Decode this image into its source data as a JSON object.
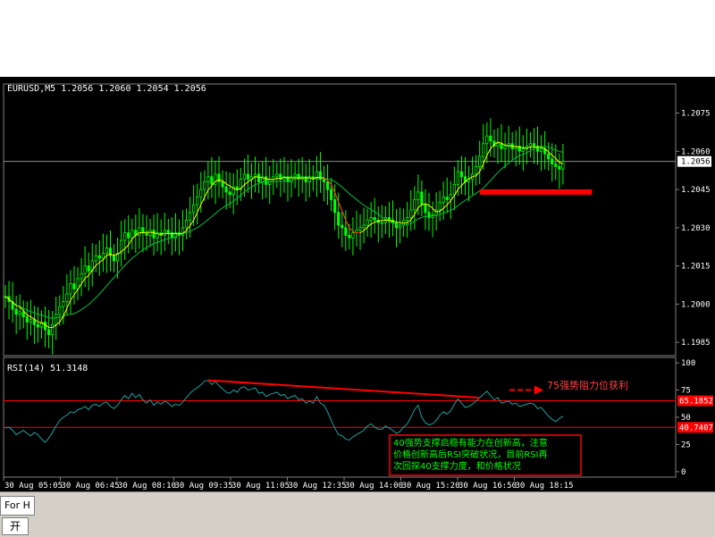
{
  "chart_data": [
    {
      "type": "line",
      "panel": "price",
      "symbol_header": "EURUSD,M5  1.2056 1.2060 1.2054 1.2056",
      "y_ticks": [
        "1.2075",
        "1.2060",
        "1.2045",
        "1.2030",
        "1.2015",
        "1.2000",
        "1.1985"
      ],
      "ylim": [
        1.19798,
        1.20864
      ],
      "current_price_label": "1.2056",
      "current_price": 1.2056,
      "x_time_labels": [
        "30 Aug 05:05",
        "30 Aug 06:45",
        "30 Aug 08:10",
        "30 Aug 09:35",
        "30 Aug 11:05",
        "30 Aug 12:35",
        "30 Aug 14:00",
        "30 Aug 15:20",
        "30 Aug 16:50",
        "30 Aug 18:15"
      ],
      "x_index_range": [
        0,
        156
      ],
      "close_prices": [
        1.2003,
        1.2001,
        1.1998,
        1.1996,
        1.1997,
        1.1995,
        1.1993,
        1.1994,
        1.1992,
        1.1991,
        1.1993,
        1.199,
        1.1988,
        1.1992,
        1.1996,
        1.1999,
        1.2001,
        1.2004,
        1.2008,
        1.2006,
        1.201,
        1.2012,
        1.2015,
        1.2013,
        1.2017,
        1.2019,
        1.2018,
        1.202,
        1.2022,
        1.2019,
        1.2017,
        1.202,
        1.2025,
        1.2028,
        1.2026,
        1.2029,
        1.2027,
        1.203,
        1.2028,
        1.2027,
        1.2029,
        1.2026,
        1.2028,
        1.2027,
        1.2029,
        1.2028,
        1.2026,
        1.2028,
        1.2027,
        1.203,
        1.2033,
        1.2036,
        1.2039,
        1.2042,
        1.2045,
        1.2048,
        1.205,
        1.2047,
        1.2051,
        1.2048,
        1.2046,
        1.2044,
        1.2043,
        1.2046,
        1.2045,
        1.2049,
        1.2051,
        1.2049,
        1.205,
        1.2051,
        1.2048,
        1.205,
        1.2047,
        1.2049,
        1.205,
        1.2051,
        1.2049,
        1.205,
        1.2048,
        1.205,
        1.2051,
        1.2049,
        1.205,
        1.2048,
        1.205,
        1.2049,
        1.2052,
        1.2049,
        1.2048,
        1.2045,
        1.2041,
        1.2036,
        1.2031,
        1.203,
        1.2027,
        1.2026,
        1.2028,
        1.2029,
        1.203,
        1.2031,
        1.2033,
        1.2034,
        1.2033,
        1.2032,
        1.2032,
        1.2034,
        1.2033,
        1.2032,
        1.203,
        1.2031,
        1.2033,
        1.2034,
        1.2037,
        1.2041,
        1.2044,
        1.2039,
        1.2036,
        1.2034,
        1.2035,
        1.2037,
        1.204,
        1.2042,
        1.2041,
        1.2043,
        1.2047,
        1.2052,
        1.205,
        1.2048,
        1.2049,
        1.2051,
        1.2054,
        1.2058,
        1.2063,
        1.2066,
        1.2064,
        1.2062,
        1.2063,
        1.2061,
        1.2062,
        1.2063,
        1.2061,
        1.2062,
        1.206,
        1.2061,
        1.2062,
        1.2063,
        1.2062,
        1.206,
        1.2061,
        1.2059,
        1.2057,
        1.2055,
        1.2054,
        1.2053,
        1.2056
      ],
      "annotation_red_bar": {
        "x_index_start": 131,
        "x_index_end": 162,
        "price": 1.2044
      }
    },
    {
      "type": "line",
      "panel": "rsi",
      "header": "RSI(14)  51.3148",
      "y_ticks": [
        "100",
        "75",
        "50",
        "25",
        "0"
      ],
      "ylim": [
        -5,
        105
      ],
      "levels": [
        {
          "value": 65.1852,
          "label": "65.1852"
        },
        {
          "value": 40.7407,
          "label": "40.7407"
        }
      ],
      "values": [
        40,
        41,
        38,
        34,
        36,
        38,
        35,
        33,
        36,
        34,
        30,
        27,
        31,
        36,
        42,
        47,
        50,
        52,
        55,
        54,
        57,
        58,
        60,
        57,
        61,
        62,
        60,
        63,
        64,
        60,
        58,
        61,
        66,
        70,
        67,
        72,
        68,
        71,
        66,
        63,
        66,
        61,
        64,
        62,
        65,
        63,
        60,
        62,
        61,
        64,
        68,
        72,
        75,
        77,
        80,
        83,
        84,
        80,
        83,
        79,
        76,
        73,
        72,
        75,
        73,
        77,
        78,
        75,
        76,
        77,
        72,
        73,
        69,
        71,
        72,
        73,
        70,
        71,
        67,
        69,
        70,
        66,
        67,
        63,
        65,
        63,
        69,
        63,
        61,
        55,
        47,
        40,
        34,
        33,
        30,
        29,
        32,
        34,
        36,
        38,
        42,
        44,
        41,
        39,
        39,
        42,
        40,
        38,
        35,
        37,
        41,
        44,
        50,
        57,
        61,
        50,
        45,
        43,
        44,
        47,
        52,
        55,
        53,
        56,
        62,
        67,
        63,
        59,
        60,
        62,
        65,
        68,
        71,
        74,
        70,
        66,
        68,
        63,
        64,
        65,
        62,
        63,
        60,
        61,
        62,
        63,
        62,
        58,
        59,
        55,
        51,
        48,
        46,
        49,
        51
      ],
      "annotation_arrow_label": "75强势阻力位获利",
      "annotation_box_lines": [
        "40强势支撑启稳有能力在创新高，注意",
        "价格创新高后RSI突破状况，目前RSI再",
        "次回探40支撑力度，和价格状况"
      ]
    }
  ],
  "bottom": {
    "tab_label": "For H",
    "icon_label": "开"
  },
  "colors": {
    "background": "#000000",
    "candles": "#00ff00",
    "ma_fast": "#ffff00",
    "ma_slow": "#00c040",
    "rsi_line": "#20a0a0",
    "level_lines": "#ff0000",
    "annotation": "#ff0000",
    "box_text": "#00ff00"
  }
}
